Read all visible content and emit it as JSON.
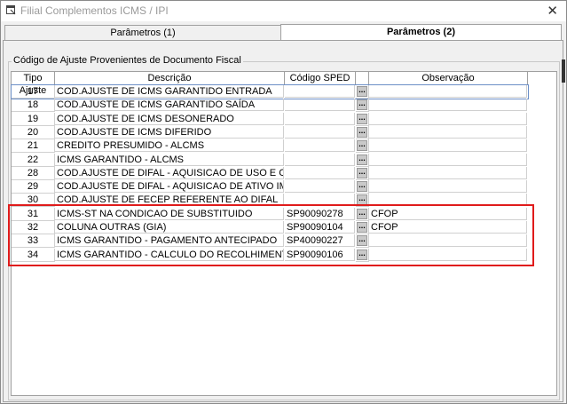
{
  "window": {
    "title": "Filial Complementos ICMS / IPI",
    "close_glyph": "✕"
  },
  "tabs": [
    {
      "label": "Parâmetros (1)"
    },
    {
      "label": "Parâmetros (2)"
    }
  ],
  "group": {
    "legend": "Código de Ajuste Provenientes de Documento Fiscal"
  },
  "grid": {
    "headers": {
      "tipo": "Tipo Ajuste",
      "desc": "Descrição",
      "sped": "Código SPED",
      "obs": "Observação"
    },
    "button_glyph": "...",
    "rows": [
      {
        "tipo": "17",
        "desc": "COD.AJUSTE DE ICMS GARANTIDO ENTRADA",
        "sped": "",
        "obs": ""
      },
      {
        "tipo": "18",
        "desc": "COD.AJUSTE DE ICMS GARANTIDO SAÍDA",
        "sped": "",
        "obs": ""
      },
      {
        "tipo": "19",
        "desc": "COD.AJUSTE DE ICMS DESONERADO",
        "sped": "",
        "obs": ""
      },
      {
        "tipo": "20",
        "desc": "COD.AJUSTE DE ICMS DIFERIDO",
        "sped": "",
        "obs": ""
      },
      {
        "tipo": "21",
        "desc": "CREDITO PRESUMIDO - ALCMS",
        "sped": "",
        "obs": ""
      },
      {
        "tipo": "22",
        "desc": "ICMS GARANTIDO - ALCMS",
        "sped": "",
        "obs": ""
      },
      {
        "tipo": "28",
        "desc": "COD.AJUSTE DE DIFAL - AQUISICAO DE USO E CONSUMO",
        "sped": "",
        "obs": ""
      },
      {
        "tipo": "29",
        "desc": "COD.AJUSTE DE DIFAL - AQUISICAO DE ATIVO IMOBILIZADO",
        "sped": "",
        "obs": ""
      },
      {
        "tipo": "30",
        "desc": "COD.AJUSTE DE FECEP REFERENTE AO DIFAL",
        "sped": "",
        "obs": ""
      },
      {
        "tipo": "31",
        "desc": "ICMS-ST NA CONDICAO DE SUBSTITUIDO",
        "sped": "SP90090278",
        "obs": "CFOP"
      },
      {
        "tipo": "32",
        "desc": "COLUNA OUTRAS (GIA)",
        "sped": "SP90090104",
        "obs": "CFOP"
      },
      {
        "tipo": "33",
        "desc": "ICMS GARANTIDO - PAGAMENTO ANTECIPADO",
        "sped": "SP40090227",
        "obs": ""
      },
      {
        "tipo": "34",
        "desc": "ICMS GARANTIDO - CALCULO DO RECOLHIMENTO",
        "sped": "SP90090106",
        "obs": ""
      }
    ]
  },
  "colors": {
    "highlight": "#e01b1b",
    "selection": "#6c8fc7"
  }
}
